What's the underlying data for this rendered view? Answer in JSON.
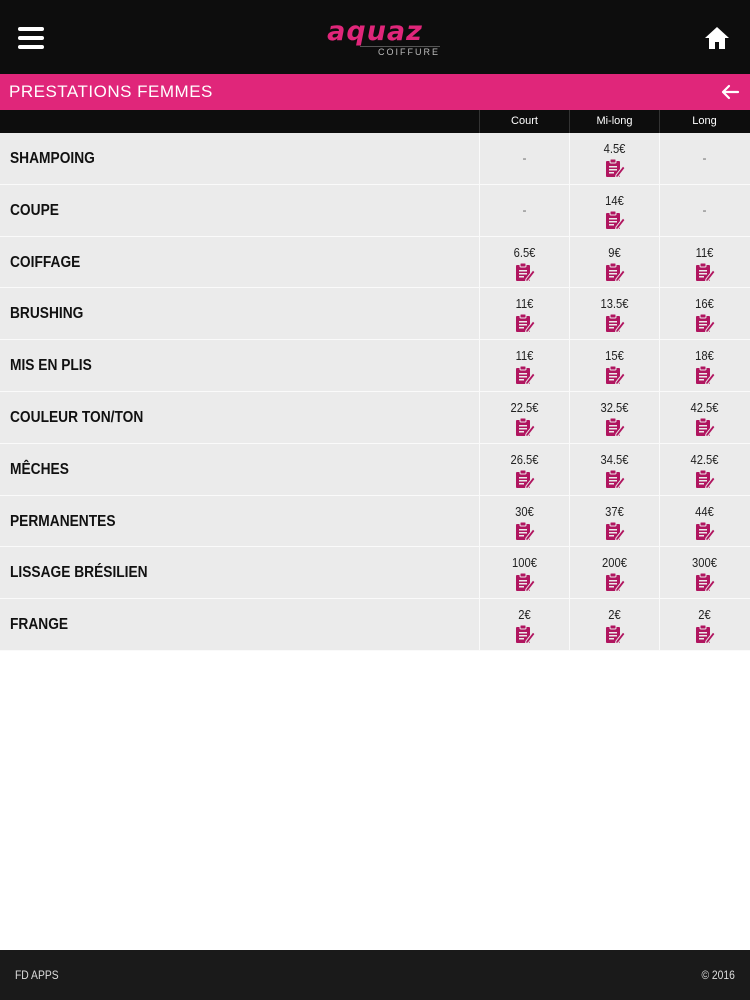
{
  "header": {
    "logo_main": "aquaz",
    "logo_sub": "COIFFURE",
    "menu_icon": "hamburger-menu-icon",
    "home_icon": "home-icon"
  },
  "titlebar": {
    "title": "PRESTATIONS FEMMES",
    "back_icon": "arrow-left-icon"
  },
  "columns": [
    "Court",
    "Mi-long",
    "Long"
  ],
  "rows": [
    {
      "label": "SHAMPOING",
      "prices": [
        "-",
        "4.5€",
        "-"
      ]
    },
    {
      "label": "COUPE",
      "prices": [
        "-",
        "14€",
        "-"
      ]
    },
    {
      "label": "COIFFAGE",
      "prices": [
        "6.5€",
        "9€",
        "11€"
      ]
    },
    {
      "label": "BRUSHING",
      "prices": [
        "11€",
        "13.5€",
        "16€"
      ]
    },
    {
      "label": "MIS EN PLIS",
      "prices": [
        "11€",
        "15€",
        "18€"
      ]
    },
    {
      "label": "COULEUR TON/TON",
      "prices": [
        "22.5€",
        "32.5€",
        "42.5€"
      ]
    },
    {
      "label": "MÊCHES",
      "prices": [
        "26.5€",
        "34.5€",
        "42.5€"
      ]
    },
    {
      "label": "PERMANENTES",
      "prices": [
        "30€",
        "37€",
        "44€"
      ]
    },
    {
      "label": "LISSAGE BRÉSILIEN",
      "prices": [
        "100€",
        "200€",
        "300€"
      ]
    },
    {
      "label": "FRANGE",
      "prices": [
        "2€",
        "2€",
        "2€"
      ]
    }
  ],
  "footer": {
    "left": "FD APPS",
    "right": "© 2016"
  },
  "colors": {
    "accent": "#e0267a",
    "icon": "#b0155f",
    "bar": "#0d0d0d",
    "row_bg": "#ebebeb"
  }
}
